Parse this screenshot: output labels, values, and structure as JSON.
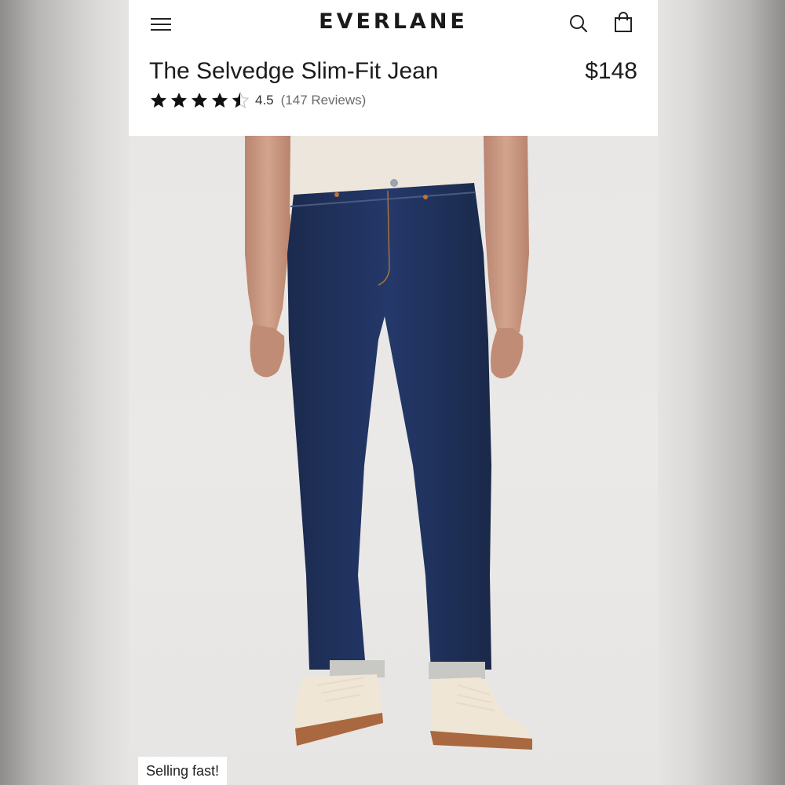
{
  "header": {
    "logo": "EVERLANE",
    "menu_icon": "hamburger-menu-icon",
    "search_icon": "search-icon",
    "bag_icon": "shopping-bag-icon"
  },
  "product": {
    "title": "The Selvedge Slim-Fit Jean",
    "price": "$148",
    "rating_value": "4.5",
    "rating_stars": 4.5,
    "reviews": "(147 Reviews)",
    "badge": "Selling fast!"
  },
  "colors": {
    "denim": "#1f3158",
    "tee": "#ede6dc",
    "sneakers": "#efe6d6",
    "sole": "#a9683f",
    "skin": "#c9977f",
    "background": "#ebe9e7"
  }
}
